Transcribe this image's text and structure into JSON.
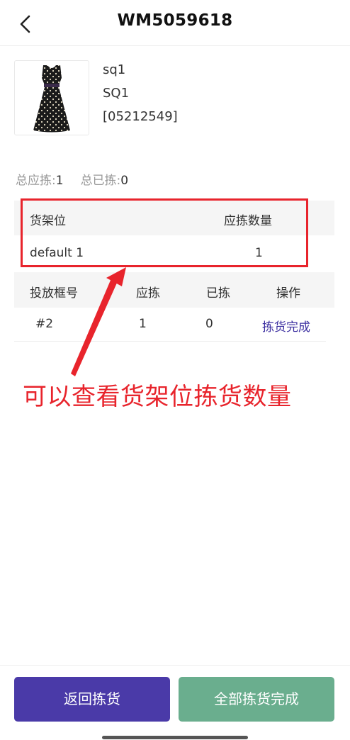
{
  "header": {
    "title": "WM5059618",
    "back_icon": "chevron-left-icon"
  },
  "product": {
    "name": "sq1",
    "sku": "SQ1",
    "code": "[05212549]",
    "image": "polka-dot-dress-image"
  },
  "totals": {
    "should_pick_label": "总应拣:",
    "should_pick_value": "1",
    "picked_label": "总已拣:",
    "picked_value": "0"
  },
  "shelf_table": {
    "col_location": "货架位",
    "col_quantity": "应拣数量",
    "rows": [
      {
        "location": "default 1",
        "quantity": "1"
      }
    ]
  },
  "box_table": {
    "col_box": "投放框号",
    "col_should": "应拣",
    "col_picked": "已拣",
    "col_action": "操作",
    "rows": [
      {
        "box": "#2",
        "should": "1",
        "picked": "0",
        "action": "拣货完成"
      }
    ]
  },
  "annotation": {
    "text": "可以查看货架位拣货数量",
    "color": "#e8242c"
  },
  "footer": {
    "back_button": "返回拣货",
    "complete_all_button": "全部拣货完成"
  },
  "colors": {
    "primary": "#4a3aa8",
    "secondary": "#6aae8e",
    "link": "#3b2ea0"
  }
}
